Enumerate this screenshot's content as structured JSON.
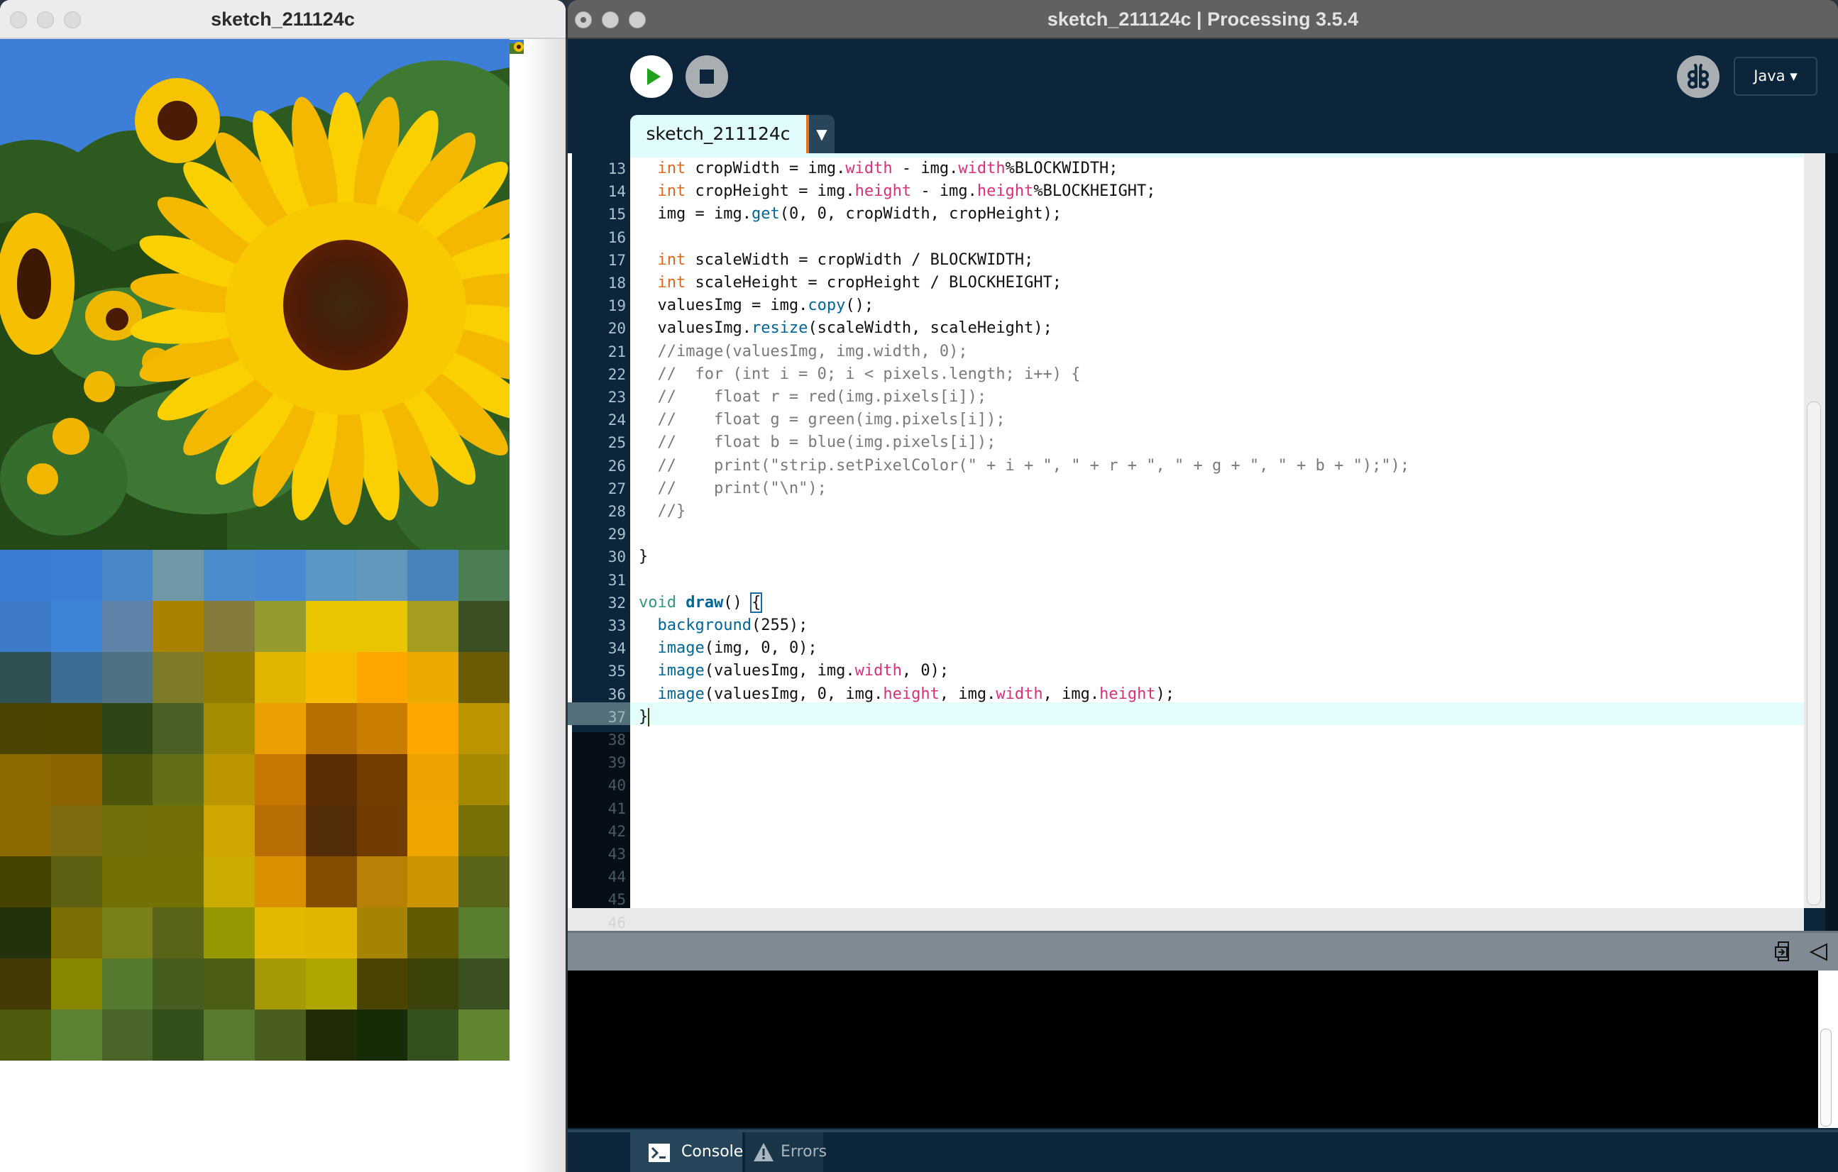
{
  "sketch_window": {
    "title": "sketch_211124c",
    "image_description": "Sunflowers under a blue sky",
    "mosaic": {
      "columns": 10,
      "rows": 10,
      "colors": [
        [
          "#3a7bd5",
          "#3a7ed8",
          "#4a88c8",
          "#7097a6",
          "#4b8ccd",
          "#4a8ad2",
          "#5b95c4",
          "#6398bc",
          "#4a82bc",
          "#4c7d55"
        ],
        [
          "#3d7ac8",
          "#3e84d6",
          "#5f82a8",
          "#a98300",
          "#847a3c",
          "#959a2e",
          "#e9c600",
          "#ebc600",
          "#a49d20",
          "#3b5022"
        ],
        [
          "#2e5050",
          "#3e6d94",
          "#4f7184",
          "#7d7a28",
          "#917b00",
          "#e0b600",
          "#f6bd00",
          "#fea500",
          "#eaaa00",
          "#6a5b04"
        ],
        [
          "#4a4400",
          "#4a4600",
          "#2e4518",
          "#4a6025",
          "#a68c00",
          "#eb9f00",
          "#b77000",
          "#c97e00",
          "#fea700",
          "#bb9400"
        ],
        [
          "#8c6a00",
          "#8c6400",
          "#4d560b",
          "#636e17",
          "#bb9500",
          "#c67700",
          "#5b2d06",
          "#713e00",
          "#eda200",
          "#a58a00"
        ],
        [
          "#8c6a00",
          "#806c10",
          "#717008",
          "#727005",
          "#d1a500",
          "#b76e04",
          "#522d08",
          "#713c00",
          "#eea500",
          "#767005"
        ],
        [
          "#454300",
          "#5d6010",
          "#737004",
          "#737004",
          "#cbac00",
          "#da8f00",
          "#844d00",
          "#b88106",
          "#cc9400",
          "#596419"
        ],
        [
          "#22320c",
          "#7a6e05",
          "#7a801a",
          "#5a6419",
          "#969800",
          "#e2b800",
          "#e0b600",
          "#a48400",
          "#625a00",
          "#5a7e30"
        ],
        [
          "#443a05",
          "#878700",
          "#567a30",
          "#455e20",
          "#4b5e13",
          "#a59a05",
          "#aea500",
          "#4b4300",
          "#3b420a",
          "#3a5020"
        ],
        [
          "#4e5b0c",
          "#5c8234",
          "#49652a",
          "#34501a",
          "#5a7a30",
          "#4a5e20",
          "#1f2c04",
          "#162c06",
          "#34501c",
          "#628530"
        ]
      ]
    }
  },
  "ide_window": {
    "title": "sketch_211124c | Processing 3.5.4",
    "toolbar": {
      "run_icon": "play-icon",
      "stop_icon": "stop-icon",
      "debug_icon": "butterfly-debugger-icon",
      "mode_label": "Java ▾"
    },
    "tabs": [
      {
        "label": "sketch_211124c",
        "active": true
      }
    ],
    "tab_menu_glyph": "▼",
    "editor": {
      "current_line": 37,
      "lines": [
        {
          "n": "13",
          "code": "  int cropWidth = img.width - img.width%BLOCKWIDTH;"
        },
        {
          "n": "14",
          "code": "  int cropHeight = img.height - img.height%BLOCKHEIGHT;"
        },
        {
          "n": "15",
          "code": "  img = img.get(0, 0, cropWidth, cropHeight);"
        },
        {
          "n": "16",
          "code": ""
        },
        {
          "n": "17",
          "code": "  int scaleWidth = cropWidth / BLOCKWIDTH;"
        },
        {
          "n": "18",
          "code": "  int scaleHeight = cropHeight / BLOCKHEIGHT;"
        },
        {
          "n": "19",
          "code": "  valuesImg = img.copy();"
        },
        {
          "n": "20",
          "code": "  valuesImg.resize(scaleWidth, scaleHeight);"
        },
        {
          "n": "21",
          "code": "  //image(valuesImg, img.width, 0);"
        },
        {
          "n": "22",
          "code": "  //  for (int i = 0; i < pixels.length; i++) {"
        },
        {
          "n": "23",
          "code": "  //    float r = red(img.pixels[i]);"
        },
        {
          "n": "24",
          "code": "  //    float g = green(img.pixels[i]);"
        },
        {
          "n": "25",
          "code": "  //    float b = blue(img.pixels[i]);"
        },
        {
          "n": "26",
          "code": "  //    print(\"strip.setPixelColor(\" + i + \", \" + r + \", \" + g + \", \" + b + \");\");"
        },
        {
          "n": "27",
          "code": "  //    print(\"\\n\");"
        },
        {
          "n": "28",
          "code": "  //}"
        },
        {
          "n": "29",
          "code": ""
        },
        {
          "n": "30",
          "code": "}"
        },
        {
          "n": "31",
          "code": ""
        },
        {
          "n": "32",
          "code": "void draw() {"
        },
        {
          "n": "33",
          "code": "  background(255);"
        },
        {
          "n": "34",
          "code": "  image(img, 0, 0);"
        },
        {
          "n": "35",
          "code": "  image(valuesImg, img.width, 0);"
        },
        {
          "n": "36",
          "code": "  image(valuesImg, 0, img.height, img.width, img.height);"
        },
        {
          "n": "37",
          "code": "}"
        },
        {
          "n": "38",
          "code": ""
        },
        {
          "n": "39",
          "code": ""
        },
        {
          "n": "40",
          "code": ""
        },
        {
          "n": "41",
          "code": ""
        },
        {
          "n": "42",
          "code": ""
        },
        {
          "n": "43",
          "code": ""
        },
        {
          "n": "44",
          "code": ""
        },
        {
          "n": "45",
          "code": ""
        },
        {
          "n": "46",
          "code": ""
        }
      ]
    },
    "console": {
      "header_icons": [
        "copy-icon",
        "collapse-triangle-icon"
      ],
      "output": ""
    },
    "footer_tabs": [
      {
        "label": "Console",
        "icon": "terminal-icon",
        "active": true
      },
      {
        "label": "Errors",
        "icon": "warning-icon",
        "active": false
      }
    ]
  },
  "colors": {
    "ide_background": "#0d253b",
    "keyword": "#e2661a",
    "field": "#d9307a",
    "function": "#006699",
    "comment": "#7a7a7a",
    "run_green": "#1ea11e",
    "tab_background": "#e0fbfb",
    "tab_accent": "#e8731a"
  }
}
